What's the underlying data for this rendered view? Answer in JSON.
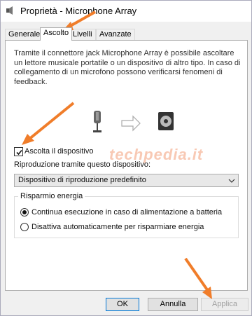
{
  "window": {
    "title": "Proprietà - Microphone Array"
  },
  "tabs": [
    {
      "label": "Generale",
      "active": false
    },
    {
      "label": "Ascolto",
      "active": true
    },
    {
      "label": "Livelli",
      "active": false
    },
    {
      "label": "Avanzate",
      "active": false
    }
  ],
  "listen": {
    "description": "Tramite il connettore jack Microphone Array è possibile ascoltare un lettore musicale portatile o un dispositivo di altro tipo. In caso di collegamento di un microfono possono verificarsi fenomeni di feedback.",
    "checkbox_label": "Ascolta il dispositivo",
    "checkbox_checked": true,
    "playback_label": "Riproduzione tramite questo dispositivo:",
    "playback_device": "Dispositivo di riproduzione predefinito"
  },
  "power": {
    "group_title": "Risparmio energia",
    "options": [
      {
        "label": "Continua esecuzione in caso di alimentazione a batteria",
        "checked": true
      },
      {
        "label": "Disattiva automaticamente per risparmiare energia",
        "checked": false
      }
    ]
  },
  "watermark": "techpedia.it",
  "buttons": {
    "ok": "OK",
    "cancel": "Annulla",
    "apply": "Applica",
    "apply_enabled": false
  },
  "colors": {
    "annotation_arrow": "#f07d2a",
    "default_button_border": "#0078d7"
  }
}
